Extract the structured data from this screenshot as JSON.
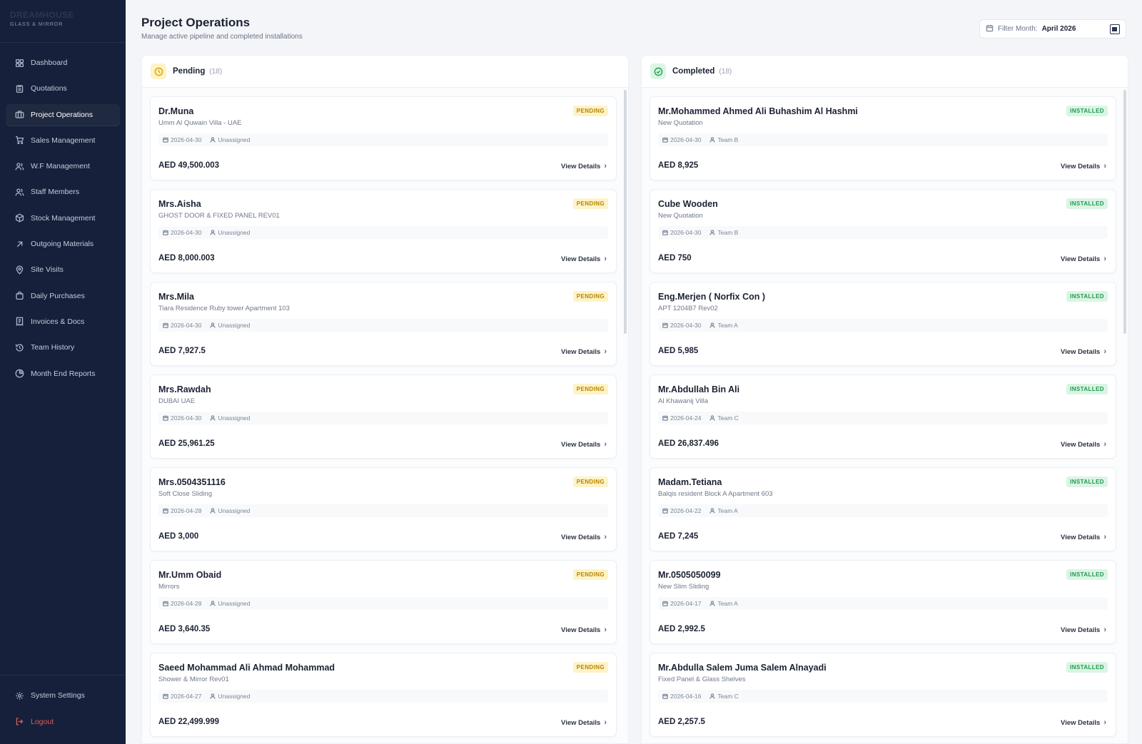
{
  "brand": {
    "name": "DREAMHOUSE",
    "sub": "GLASS & MIRROR"
  },
  "nav": [
    {
      "label": "Dashboard",
      "icon": "dashboard-icon"
    },
    {
      "label": "Quotations",
      "icon": "clipboard-icon"
    },
    {
      "label": "Project Operations",
      "icon": "briefcase-icon",
      "active": true
    },
    {
      "label": "Sales Management",
      "icon": "cart-icon"
    },
    {
      "label": "W.F Management",
      "icon": "users-icon"
    },
    {
      "label": "Staff Members",
      "icon": "users-icon"
    },
    {
      "label": "Stock Management",
      "icon": "box-icon"
    },
    {
      "label": "Outgoing Materials",
      "icon": "arrow-up-right-icon"
    },
    {
      "label": "Site Visits",
      "icon": "map-pin-icon"
    },
    {
      "label": "Daily Purchases",
      "icon": "bag-icon"
    },
    {
      "label": "Invoices & Docs",
      "icon": "receipt-icon"
    },
    {
      "label": "Team History",
      "icon": "history-icon"
    },
    {
      "label": "Month End Reports",
      "icon": "pie-chart-icon"
    }
  ],
  "nav_bottom": {
    "settings": "System Settings",
    "logout": "Logout"
  },
  "header": {
    "title": "Project Operations",
    "subtitle": "Manage active pipeline and completed installations",
    "filter_label": "Filter Month:",
    "filter_value": "April 2026"
  },
  "pending": {
    "title": "Pending",
    "count": "(18)",
    "cards": [
      {
        "name": "Dr.Muna",
        "desc": "Umm Al Quwain Villa - UAE",
        "status": "PENDING",
        "date": "2026-04-30",
        "team": "Unassigned",
        "amount": "AED 49,500.003",
        "action": "View Details"
      },
      {
        "name": "Mrs.Aisha",
        "desc": "GHOST DOOR & FIXED PANEL REV01",
        "status": "PENDING",
        "date": "2026-04-30",
        "team": "Unassigned",
        "amount": "AED 8,000.003",
        "action": "View Details"
      },
      {
        "name": "Mrs.Mila",
        "desc": "Tiara Residence Ruby tower Apartment 103",
        "status": "PENDING",
        "date": "2026-04-30",
        "team": "Unassigned",
        "amount": "AED 7,927.5",
        "action": "View Details"
      },
      {
        "name": "Mrs.Rawdah",
        "desc": "DUBAI UAE",
        "status": "PENDING",
        "date": "2026-04-30",
        "team": "Unassigned",
        "amount": "AED 25,961.25",
        "action": "View Details"
      },
      {
        "name": "Mrs.0504351116",
        "desc": "Soft Close Sliding",
        "status": "PENDING",
        "date": "2026-04-28",
        "team": "Unassigned",
        "amount": "AED 3,000",
        "action": "View Details"
      },
      {
        "name": "Mr.Umm Obaid",
        "desc": "Mirrors",
        "status": "PENDING",
        "date": "2026-04-28",
        "team": "Unassigned",
        "amount": "AED 3,640.35",
        "action": "View Details"
      },
      {
        "name": "Saeed Mohammad Ali Ahmad Mohammad",
        "desc": "Shower & Mirror Rev01",
        "status": "PENDING",
        "date": "2026-04-27",
        "team": "Unassigned",
        "amount": "AED 22,499.999",
        "action": "View Details"
      }
    ]
  },
  "completed": {
    "title": "Completed",
    "count": "(18)",
    "cards": [
      {
        "name": "Mr.Mohammed Ahmed Ali Buhashim Al Hashmi",
        "desc": "New Quotation",
        "status": "INSTALLED",
        "date": "2026-04-30",
        "team": "Team B",
        "amount": "AED 8,925",
        "action": "View Details"
      },
      {
        "name": "Cube Wooden",
        "desc": "New Quotation",
        "status": "INSTALLED",
        "date": "2026-04-30",
        "team": "Team B",
        "amount": "AED 750",
        "action": "View Details"
      },
      {
        "name": "Eng.Merjen ( Norfix Con )",
        "desc": "APT 1204B7 Rev02",
        "status": "INSTALLED",
        "date": "2026-04-30",
        "team": "Team A",
        "amount": "AED 5,985",
        "action": "View Details"
      },
      {
        "name": "Mr.Abdullah Bin Ali",
        "desc": "Al Khawanij Villa",
        "status": "INSTALLED",
        "date": "2026-04-24",
        "team": "Team C",
        "amount": "AED 26,837.496",
        "action": "View Details"
      },
      {
        "name": "Madam.Tetiana",
        "desc": "Balqis resident Block A Apartment 603",
        "status": "INSTALLED",
        "date": "2026-04-22",
        "team": "Team A",
        "amount": "AED 7,245",
        "action": "View Details"
      },
      {
        "name": "Mr.0505050099",
        "desc": "New Slim Sliding",
        "status": "INSTALLED",
        "date": "2026-04-17",
        "team": "Team A",
        "amount": "AED 2,992.5",
        "action": "View Details"
      },
      {
        "name": "Mr.Abdulla Salem Juma Salem Alnayadi",
        "desc": "Fixed Panel & Glass Shelves",
        "status": "INSTALLED",
        "date": "2026-04-16",
        "team": "Team C",
        "amount": "AED 2,257.5",
        "action": "View Details"
      }
    ]
  }
}
